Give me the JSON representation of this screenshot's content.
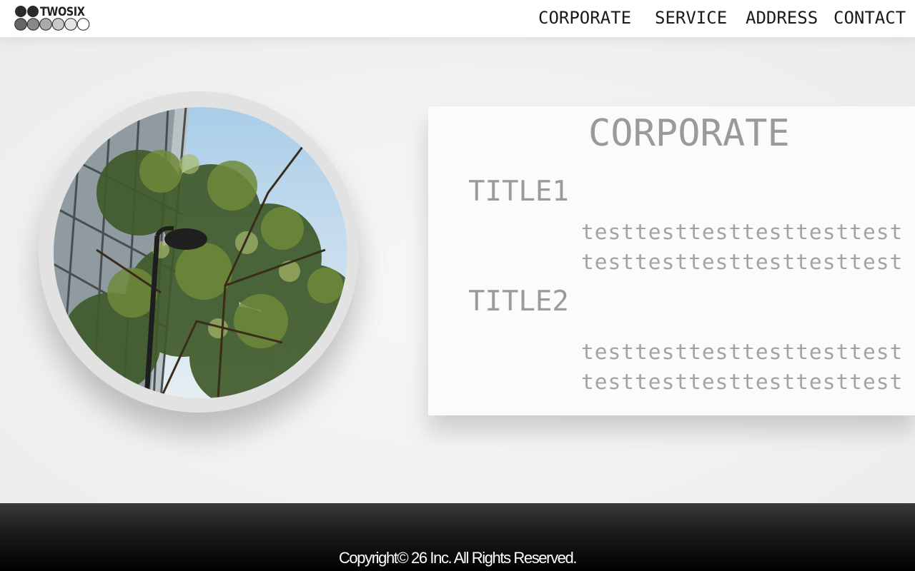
{
  "header": {
    "logo_text": "TWOSIX",
    "nav": [
      {
        "label": "CORPORATE"
      },
      {
        "label": "SERVICE"
      },
      {
        "label": "ADDRESS"
      },
      {
        "label": "CONTACT"
      }
    ]
  },
  "main": {
    "photo_icon": "trees-photo",
    "card": {
      "title": "CORPORATE",
      "sections": [
        {
          "title": "TITLE1",
          "lines": [
            "testtesttesttesttesttest",
            "testtesttesttesttesttest"
          ]
        },
        {
          "title": "TITLE2",
          "lines": [
            "testtesttesttesttesttest",
            "testtesttesttesttesttest"
          ]
        }
      ]
    }
  },
  "footer": {
    "copyright": "Copyright© 26 Inc. All Rights Reserved."
  },
  "colors": {
    "header_bg": "#ffffff",
    "page_bg": "#f1f1f1",
    "card_text": "#9a9a9a",
    "footer_bg": "#000000"
  }
}
